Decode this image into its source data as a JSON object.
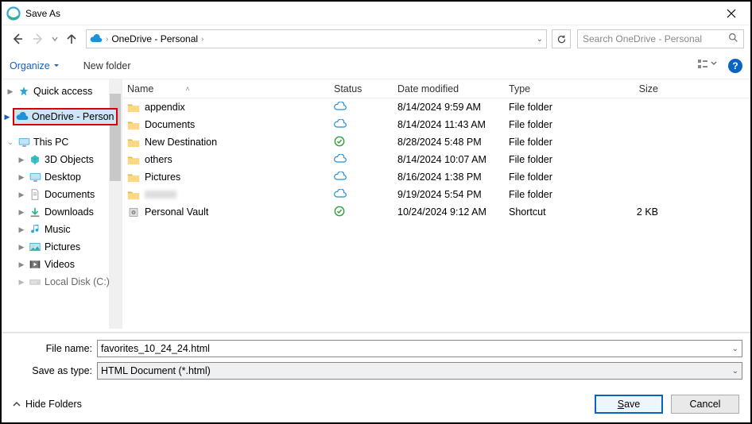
{
  "title": "Save As",
  "breadcrumb": {
    "location": "OneDrive - Personal",
    "chev": "›"
  },
  "search": {
    "placeholder": "Search OneDrive - Personal"
  },
  "toolbar": {
    "organize": "Organize",
    "newfolder": "New folder"
  },
  "columns": {
    "name": "Name",
    "status": "Status",
    "date": "Date modified",
    "type": "Type",
    "size": "Size"
  },
  "tree": {
    "quickaccess": "Quick access",
    "onedrive": "OneDrive - Person",
    "thispc": "This PC",
    "children": [
      "3D Objects",
      "Desktop",
      "Documents",
      "Downloads",
      "Music",
      "Pictures",
      "Videos",
      "Local Disk (C:)"
    ]
  },
  "rows": [
    {
      "name": "appendix",
      "status": "cloud",
      "date": "8/14/2024 9:59 AM",
      "type": "File folder",
      "size": ""
    },
    {
      "name": "Documents",
      "status": "cloud",
      "date": "8/14/2024 11:43 AM",
      "type": "File folder",
      "size": ""
    },
    {
      "name": "New Destination",
      "status": "synced",
      "date": "8/28/2024 5:48 PM",
      "type": "File folder",
      "size": ""
    },
    {
      "name": "others",
      "status": "cloud",
      "date": "8/14/2024 10:07 AM",
      "type": "File folder",
      "size": ""
    },
    {
      "name": "Pictures",
      "status": "cloud",
      "date": "8/16/2024 1:38 PM",
      "type": "File folder",
      "size": ""
    },
    {
      "name": "",
      "status": "cloud",
      "date": "9/19/2024 5:54 PM",
      "type": "File folder",
      "size": "",
      "blurred": true
    },
    {
      "name": "Personal Vault",
      "status": "synced",
      "date": "10/24/2024 9:12 AM",
      "type": "Shortcut",
      "size": "2 KB",
      "vault": true
    }
  ],
  "filefields": {
    "name_label": "File name:",
    "name_value": "favorites_10_24_24.html",
    "type_label": "Save as type:",
    "type_value": "HTML Document (*.html)"
  },
  "footer": {
    "hide": "Hide Folders",
    "save": "Save",
    "cancel": "Cancel"
  }
}
